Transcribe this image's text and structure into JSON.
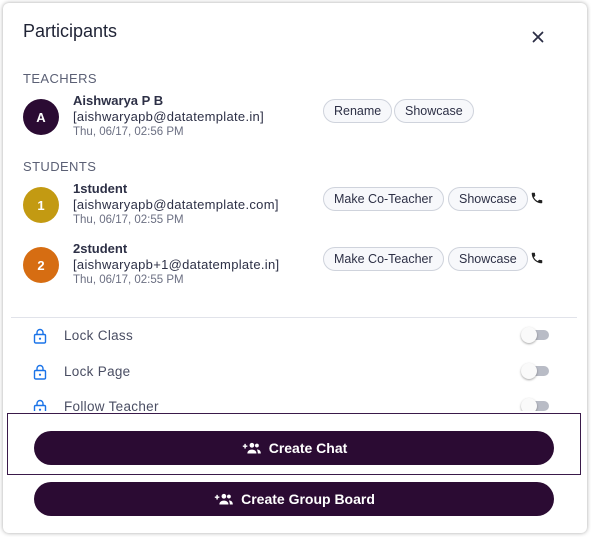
{
  "dialog": {
    "title": "Participants"
  },
  "teachers": {
    "heading": "TEACHERS",
    "items": [
      {
        "initial": "A",
        "avatar_color": "#2b0b33",
        "name": "Aishwarya P B",
        "email": "[aishwaryapb@datatemplate.in]",
        "time": "Thu, 06/17, 02:56 PM",
        "actions": [
          "Rename",
          "Showcase"
        ]
      }
    ]
  },
  "students": {
    "heading": "STUDENTS",
    "items": [
      {
        "initial": "1",
        "avatar_color": "#c39a12",
        "name": "1student",
        "email": "[aishwaryapb@datatemplate.com]",
        "time": "Thu, 06/17, 02:55 PM",
        "actions": [
          "Make Co-Teacher",
          "Showcase"
        ]
      },
      {
        "initial": "2",
        "avatar_color": "#d66d12",
        "name": "2student",
        "email": "[aishwaryapb+1@datatemplate.in]",
        "time": "Thu, 06/17, 02:55 PM",
        "actions": [
          "Make Co-Teacher",
          "Showcase"
        ]
      }
    ]
  },
  "options": [
    {
      "label": "Lock Class",
      "enabled": false
    },
    {
      "label": "Lock Page",
      "enabled": false
    },
    {
      "label": "Follow Teacher",
      "enabled": false
    }
  ],
  "buttons": {
    "create_chat": "Create Chat",
    "create_group_board": "Create Group Board"
  },
  "colors": {
    "primary": "#2b0b33",
    "accent_icon": "#1a73e8"
  }
}
